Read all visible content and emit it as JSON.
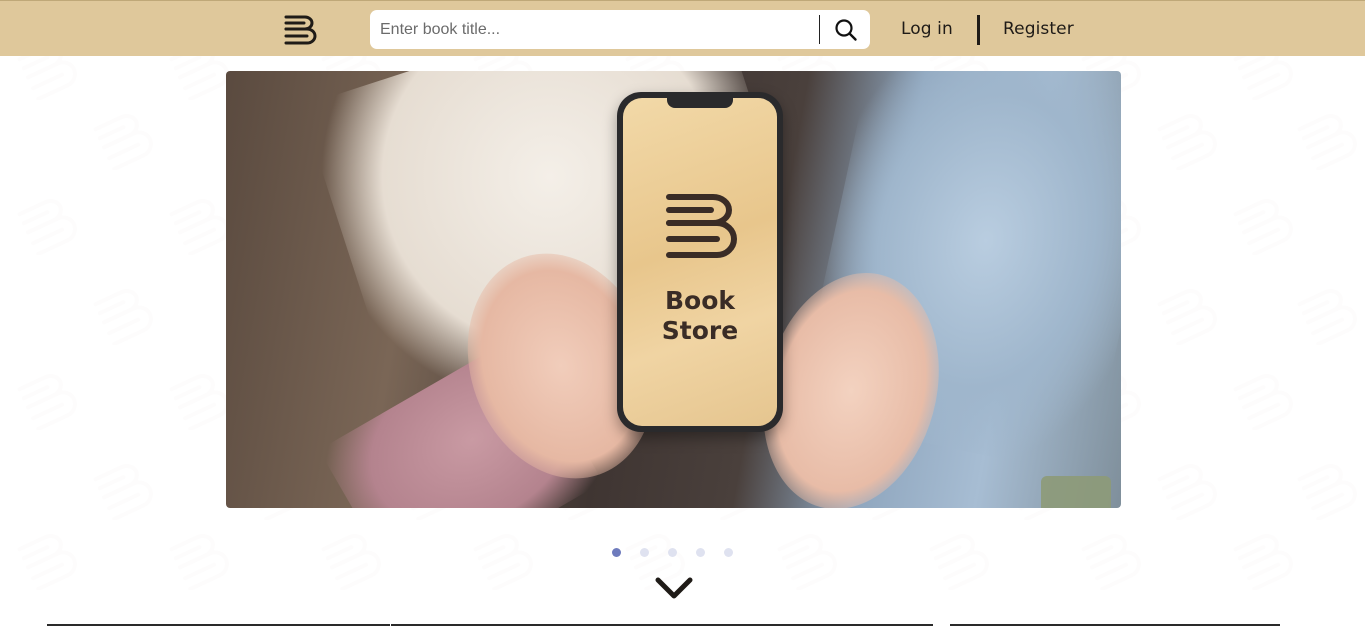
{
  "header": {
    "logo_icon": "bookstore-b-icon",
    "search": {
      "placeholder": "Enter book title...",
      "value": "",
      "button_icon": "search-icon"
    },
    "nav": {
      "login_label": "Log in",
      "register_label": "Register"
    }
  },
  "carousel": {
    "slide_brand_line1": "Book",
    "slide_brand_line2": "Store",
    "slide_count": 5,
    "active_index": 0
  },
  "scroll_down_icon": "chevron-down-icon",
  "colors": {
    "header_bg": "#dfc89b",
    "text_dark": "#1f1b17",
    "dot_active": "#6e7bbd",
    "dot_inactive": "#dfe2f0"
  }
}
